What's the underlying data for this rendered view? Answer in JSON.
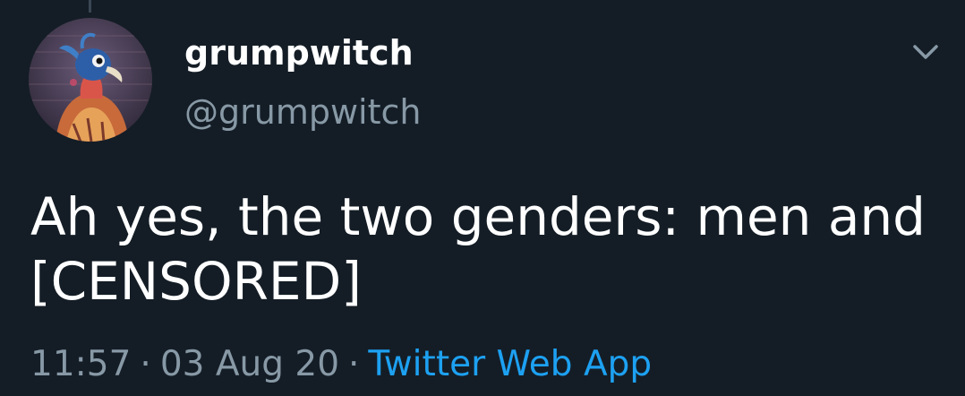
{
  "tweet": {
    "display_name": "grumpwitch",
    "handle": "@grumpwitch",
    "text_line1": "Ah yes, the two genders: men and",
    "text_line2": "[CENSORED]",
    "time": "11:57",
    "separator": "·",
    "date": "03 Aug 20",
    "source": "Twitter Web App"
  },
  "colors": {
    "background": "#141d26",
    "secondary_text": "#8899a6",
    "link": "#1da1f2"
  },
  "icons": {
    "menu": "chevron-down-icon"
  }
}
